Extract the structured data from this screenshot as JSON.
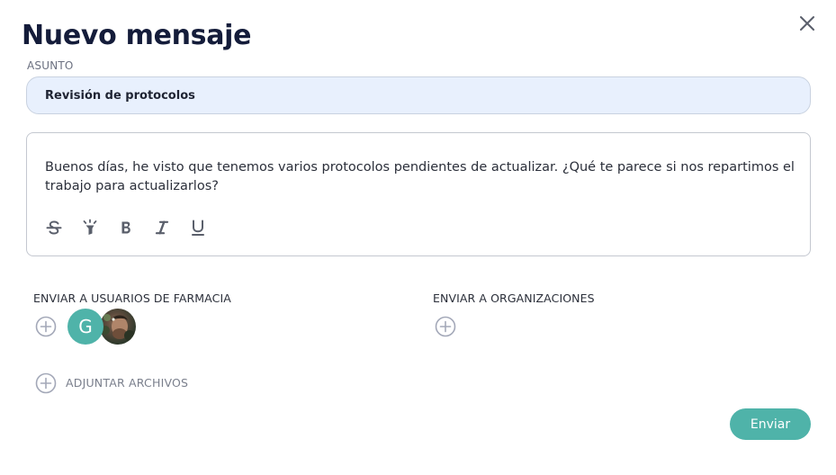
{
  "dialog": {
    "title": "Nuevo mensaje",
    "close_icon": "close-icon"
  },
  "subject": {
    "label": "ASUNTO",
    "value": "Revisión de protocolos"
  },
  "message": {
    "text": "Buenos días, he visto que tenemos varios protocolos pendientes de actualizar. ¿Qué te parece si nos repartimos el trabajo para actualizarlos?",
    "toolbar": [
      "strikethrough-icon",
      "highlight-icon",
      "bold-icon",
      "italic-icon",
      "underline-icon"
    ]
  },
  "recipients": {
    "users_label": "ENVIAR A USUARIOS DE FARMACIA",
    "users": [
      {
        "initial": "G",
        "color": "#4fb3a9"
      },
      {
        "type": "photo"
      }
    ],
    "orgs_label": "ENVIAR A ORGANIZACIONES"
  },
  "attachments": {
    "label": "ADJUNTAR ARCHIVOS"
  },
  "actions": {
    "send_label": "Enviar"
  },
  "colors": {
    "accent": "#4fb3a9",
    "subject_bg": "#e8f0fd",
    "title": "#141c3a"
  }
}
